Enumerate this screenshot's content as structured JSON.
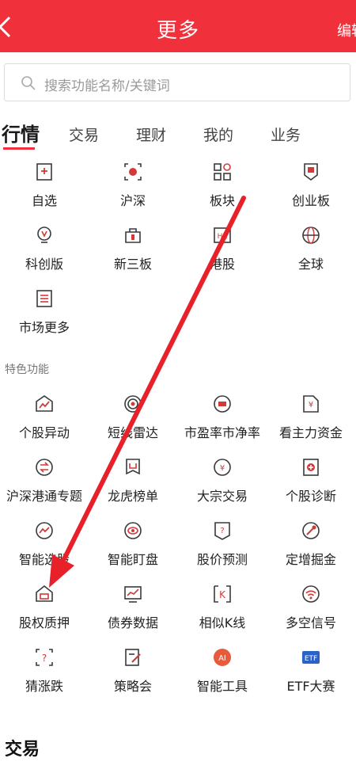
{
  "header": {
    "title": "更多",
    "edit_label": "编辑"
  },
  "search": {
    "placeholder": "搜索功能名称/关键词"
  },
  "tabs": [
    {
      "label": "行情",
      "active": true
    },
    {
      "label": "交易"
    },
    {
      "label": "理财"
    },
    {
      "label": "我的"
    },
    {
      "label": "业务"
    }
  ],
  "market_items": [
    {
      "label": "自选",
      "icon": "watchlist-icon"
    },
    {
      "label": "沪深",
      "icon": "sh-sz-icon"
    },
    {
      "label": "板块",
      "icon": "sector-icon"
    },
    {
      "label": "创业板",
      "icon": "chinext-icon"
    },
    {
      "label": "科创版",
      "icon": "star-market-icon"
    },
    {
      "label": "新三板",
      "icon": "neeq-icon"
    },
    {
      "label": "港股",
      "icon": "hk-stock-icon"
    },
    {
      "label": "全球",
      "icon": "globe-icon"
    },
    {
      "label": "市场更多",
      "icon": "more-market-icon"
    }
  ],
  "features_section": {
    "title": "特色功能"
  },
  "feature_items": [
    {
      "label": "个股异动",
      "icon": "stock-alert-icon"
    },
    {
      "label": "短线雷达",
      "icon": "radar-icon"
    },
    {
      "label": "市盈率市净率",
      "icon": "pe-pb-icon"
    },
    {
      "label": "看主力资金",
      "icon": "main-funds-icon"
    },
    {
      "label": "沪深港通专题",
      "icon": "connect-icon"
    },
    {
      "label": "龙虎榜单",
      "icon": "dragon-tiger-icon"
    },
    {
      "label": "大宗交易",
      "icon": "block-trade-icon"
    },
    {
      "label": "个股诊断",
      "icon": "diagnosis-icon"
    },
    {
      "label": "智能选股",
      "icon": "smart-pick-icon"
    },
    {
      "label": "智能盯盘",
      "icon": "smart-watch-icon"
    },
    {
      "label": "股价预测",
      "icon": "forecast-icon"
    },
    {
      "label": "定增掘金",
      "icon": "placement-icon"
    },
    {
      "label": "股权质押",
      "icon": "pledge-icon"
    },
    {
      "label": "债券数据",
      "icon": "bond-data-icon"
    },
    {
      "label": "相似K线",
      "icon": "kline-icon"
    },
    {
      "label": "多空信号",
      "icon": "signal-icon"
    },
    {
      "label": "猜涨跌",
      "icon": "guess-icon"
    },
    {
      "label": "策略会",
      "icon": "strategy-icon"
    },
    {
      "label": "智能工具",
      "icon": "ai-tool-icon"
    },
    {
      "label": "ETF大赛",
      "icon": "etf-icon"
    }
  ],
  "trade_section": {
    "title": "交易"
  },
  "colors": {
    "accent": "#f0303a",
    "icon_red": "#d23a3a",
    "icon_dark": "#3a3a3a"
  }
}
